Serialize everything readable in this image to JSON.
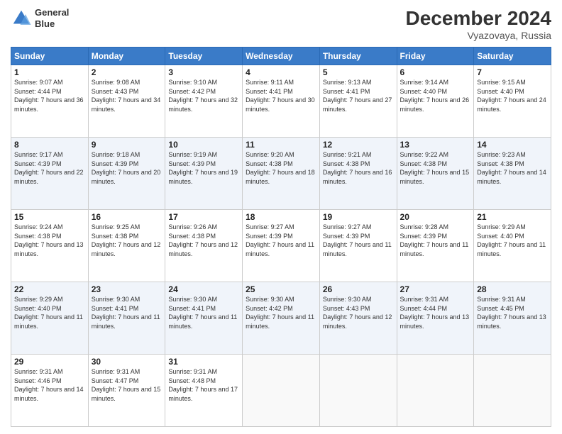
{
  "header": {
    "logo_line1": "General",
    "logo_line2": "Blue",
    "month": "December 2024",
    "location": "Vyazovaya, Russia"
  },
  "weekdays": [
    "Sunday",
    "Monday",
    "Tuesday",
    "Wednesday",
    "Thursday",
    "Friday",
    "Saturday"
  ],
  "weeks": [
    [
      {
        "day": "1",
        "sunrise": "Sunrise: 9:07 AM",
        "sunset": "Sunset: 4:44 PM",
        "daylight": "Daylight: 7 hours and 36 minutes."
      },
      {
        "day": "2",
        "sunrise": "Sunrise: 9:08 AM",
        "sunset": "Sunset: 4:43 PM",
        "daylight": "Daylight: 7 hours and 34 minutes."
      },
      {
        "day": "3",
        "sunrise": "Sunrise: 9:10 AM",
        "sunset": "Sunset: 4:42 PM",
        "daylight": "Daylight: 7 hours and 32 minutes."
      },
      {
        "day": "4",
        "sunrise": "Sunrise: 9:11 AM",
        "sunset": "Sunset: 4:41 PM",
        "daylight": "Daylight: 7 hours and 30 minutes."
      },
      {
        "day": "5",
        "sunrise": "Sunrise: 9:13 AM",
        "sunset": "Sunset: 4:41 PM",
        "daylight": "Daylight: 7 hours and 27 minutes."
      },
      {
        "day": "6",
        "sunrise": "Sunrise: 9:14 AM",
        "sunset": "Sunset: 4:40 PM",
        "daylight": "Daylight: 7 hours and 26 minutes."
      },
      {
        "day": "7",
        "sunrise": "Sunrise: 9:15 AM",
        "sunset": "Sunset: 4:40 PM",
        "daylight": "Daylight: 7 hours and 24 minutes."
      }
    ],
    [
      {
        "day": "8",
        "sunrise": "Sunrise: 9:17 AM",
        "sunset": "Sunset: 4:39 PM",
        "daylight": "Daylight: 7 hours and 22 minutes."
      },
      {
        "day": "9",
        "sunrise": "Sunrise: 9:18 AM",
        "sunset": "Sunset: 4:39 PM",
        "daylight": "Daylight: 7 hours and 20 minutes."
      },
      {
        "day": "10",
        "sunrise": "Sunrise: 9:19 AM",
        "sunset": "Sunset: 4:39 PM",
        "daylight": "Daylight: 7 hours and 19 minutes."
      },
      {
        "day": "11",
        "sunrise": "Sunrise: 9:20 AM",
        "sunset": "Sunset: 4:38 PM",
        "daylight": "Daylight: 7 hours and 18 minutes."
      },
      {
        "day": "12",
        "sunrise": "Sunrise: 9:21 AM",
        "sunset": "Sunset: 4:38 PM",
        "daylight": "Daylight: 7 hours and 16 minutes."
      },
      {
        "day": "13",
        "sunrise": "Sunrise: 9:22 AM",
        "sunset": "Sunset: 4:38 PM",
        "daylight": "Daylight: 7 hours and 15 minutes."
      },
      {
        "day": "14",
        "sunrise": "Sunrise: 9:23 AM",
        "sunset": "Sunset: 4:38 PM",
        "daylight": "Daylight: 7 hours and 14 minutes."
      }
    ],
    [
      {
        "day": "15",
        "sunrise": "Sunrise: 9:24 AM",
        "sunset": "Sunset: 4:38 PM",
        "daylight": "Daylight: 7 hours and 13 minutes."
      },
      {
        "day": "16",
        "sunrise": "Sunrise: 9:25 AM",
        "sunset": "Sunset: 4:38 PM",
        "daylight": "Daylight: 7 hours and 12 minutes."
      },
      {
        "day": "17",
        "sunrise": "Sunrise: 9:26 AM",
        "sunset": "Sunset: 4:38 PM",
        "daylight": "Daylight: 7 hours and 12 minutes."
      },
      {
        "day": "18",
        "sunrise": "Sunrise: 9:27 AM",
        "sunset": "Sunset: 4:39 PM",
        "daylight": "Daylight: 7 hours and 11 minutes."
      },
      {
        "day": "19",
        "sunrise": "Sunrise: 9:27 AM",
        "sunset": "Sunset: 4:39 PM",
        "daylight": "Daylight: 7 hours and 11 minutes."
      },
      {
        "day": "20",
        "sunrise": "Sunrise: 9:28 AM",
        "sunset": "Sunset: 4:39 PM",
        "daylight": "Daylight: 7 hours and 11 minutes."
      },
      {
        "day": "21",
        "sunrise": "Sunrise: 9:29 AM",
        "sunset": "Sunset: 4:40 PM",
        "daylight": "Daylight: 7 hours and 11 minutes."
      }
    ],
    [
      {
        "day": "22",
        "sunrise": "Sunrise: 9:29 AM",
        "sunset": "Sunset: 4:40 PM",
        "daylight": "Daylight: 7 hours and 11 minutes."
      },
      {
        "day": "23",
        "sunrise": "Sunrise: 9:30 AM",
        "sunset": "Sunset: 4:41 PM",
        "daylight": "Daylight: 7 hours and 11 minutes."
      },
      {
        "day": "24",
        "sunrise": "Sunrise: 9:30 AM",
        "sunset": "Sunset: 4:41 PM",
        "daylight": "Daylight: 7 hours and 11 minutes."
      },
      {
        "day": "25",
        "sunrise": "Sunrise: 9:30 AM",
        "sunset": "Sunset: 4:42 PM",
        "daylight": "Daylight: 7 hours and 11 minutes."
      },
      {
        "day": "26",
        "sunrise": "Sunrise: 9:30 AM",
        "sunset": "Sunset: 4:43 PM",
        "daylight": "Daylight: 7 hours and 12 minutes."
      },
      {
        "day": "27",
        "sunrise": "Sunrise: 9:31 AM",
        "sunset": "Sunset: 4:44 PM",
        "daylight": "Daylight: 7 hours and 13 minutes."
      },
      {
        "day": "28",
        "sunrise": "Sunrise: 9:31 AM",
        "sunset": "Sunset: 4:45 PM",
        "daylight": "Daylight: 7 hours and 13 minutes."
      }
    ],
    [
      {
        "day": "29",
        "sunrise": "Sunrise: 9:31 AM",
        "sunset": "Sunset: 4:46 PM",
        "daylight": "Daylight: 7 hours and 14 minutes."
      },
      {
        "day": "30",
        "sunrise": "Sunrise: 9:31 AM",
        "sunset": "Sunset: 4:47 PM",
        "daylight": "Daylight: 7 hours and 15 minutes."
      },
      {
        "day": "31",
        "sunrise": "Sunrise: 9:31 AM",
        "sunset": "Sunset: 4:48 PM",
        "daylight": "Daylight: 7 hours and 17 minutes."
      },
      null,
      null,
      null,
      null
    ]
  ]
}
